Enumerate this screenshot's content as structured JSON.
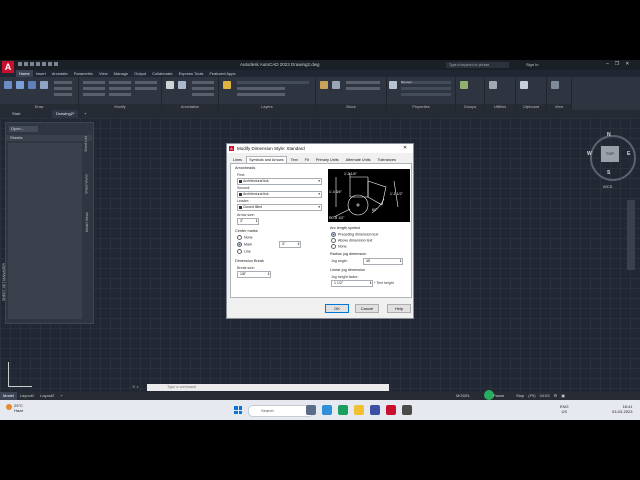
{
  "app": {
    "logo_letter": "A",
    "title": "Autodesk AutoCAD 2023    Drawing2.dwg",
    "search_placeholder": "Type a keyword or phrase",
    "signin": "Sign In",
    "window_controls": [
      "–",
      "❐",
      "✕"
    ]
  },
  "ribbon": {
    "tabs": [
      "Home",
      "Insert",
      "Annotate",
      "Parametric",
      "View",
      "Manage",
      "Output",
      "Collaborate",
      "Express Tools",
      "Featured Apps"
    ],
    "active_tab": "Home",
    "panels": [
      "Draw",
      "Modify",
      "Annotation",
      "Layers",
      "Block",
      "Properties",
      "Groups",
      "Utilities",
      "Clipboard",
      "View"
    ],
    "bylayer": "ByLayer"
  },
  "file_tabs": {
    "start": "Start",
    "drawing": "Drawing2*",
    "plus": "+"
  },
  "sheet_set": {
    "dropdown": "Open...",
    "sheets_label": "Sheets",
    "vertical_title": "SHEET SET MANAGER",
    "side_tabs": [
      "Sheet List",
      "Sheet Views",
      "Model Views"
    ]
  },
  "viewcube": {
    "top": "TOP",
    "n": "N",
    "s": "S",
    "e": "E",
    "w": "W",
    "ucs": "WCS"
  },
  "command": {
    "placeholder": "Type  a  command"
  },
  "layout_tabs": [
    "Model",
    "Layout1",
    "Layout2",
    "+"
  ],
  "status": {
    "model": "MODEL",
    "paper": "Pause",
    "items": [
      "Stop",
      "(F9)",
      "04:03",
      "⚙",
      "▣"
    ]
  },
  "taskbar": {
    "temp": "29°C",
    "weather": "Haze",
    "search": "Search",
    "tray_lang": "ENG",
    "tray_region": "US",
    "time": "18:41",
    "date": "03-03-2023"
  },
  "dialog": {
    "title": "Modify Dimension Style: Standard",
    "close": "✕",
    "tabs": [
      "Lines",
      "Symbols and Arrows",
      "Text",
      "Fit",
      "Primary Units",
      "Alternate Units",
      "Tolerances"
    ],
    "active_tab": "Symbols and Arrows",
    "arrowheads": {
      "title": "Arrowheads",
      "first_label": "First:",
      "first_value": "Architectural tick",
      "second_label": "Second:",
      "second_value": "Architectural tick",
      "leader_label": "Leader:",
      "leader_value": "Closed filled",
      "size_label": "Arrow size:",
      "size_value": "3\""
    },
    "center_marks": {
      "title": "Center marks",
      "none": "None",
      "mark": "Mark",
      "line": "Line",
      "value": "3\""
    },
    "dim_break": {
      "title": "Dimension Break",
      "size_label": "Break size:",
      "size_value": "1/8\""
    },
    "preview_labels": [
      "1'-0 1/4\"",
      "1'-4 3/4\"",
      "1'-1 1/2\"",
      "60°",
      "R0'-8 1/2\""
    ],
    "arc_length": {
      "title": "Arc length symbol",
      "preceding": "Preceding dimension text",
      "above": "Above dimension text",
      "none": "None"
    },
    "radius_jog": {
      "title": "Radius jog dimension",
      "angle_label": "Jog angle:",
      "angle_value": "45"
    },
    "linear_jog": {
      "title": "Linear jog dimension",
      "factor_label": "Jog height factor:",
      "factor_value": "1 1/2\"",
      "text_height": "* Text height"
    },
    "buttons": {
      "ok": "OK",
      "cancel": "Cancel",
      "help": "Help"
    }
  },
  "colors": {
    "accent": "#c8102e",
    "canvas": "#212833",
    "status_green": "#27ae60",
    "win_blue": "#0a74da"
  }
}
